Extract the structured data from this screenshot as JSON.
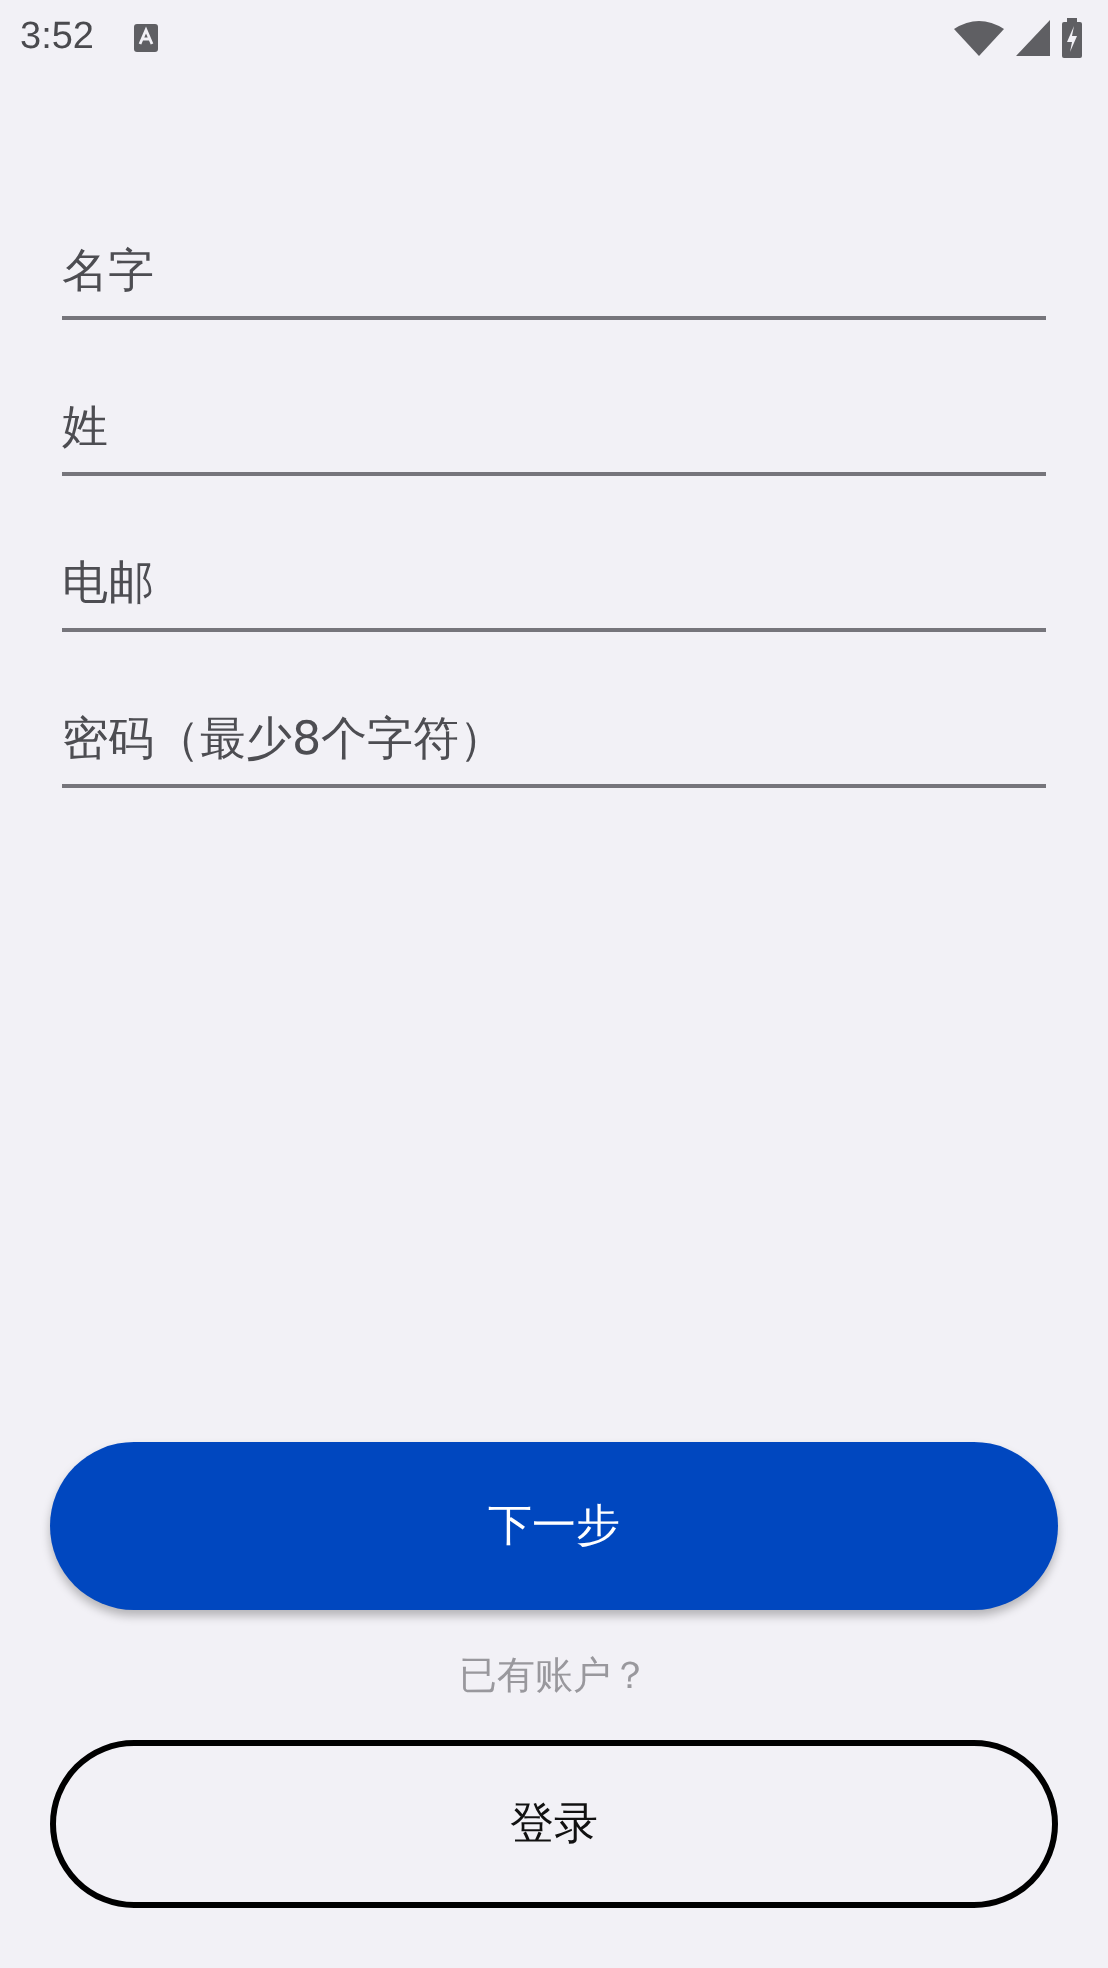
{
  "status_bar": {
    "time": "3:52"
  },
  "fields": [
    {
      "placeholder": "名字"
    },
    {
      "placeholder": "姓"
    },
    {
      "placeholder": "电邮"
    },
    {
      "placeholder": "密码（最少8个字符）"
    }
  ],
  "actions": [
    {
      "kind": "primary",
      "label": "下一步"
    },
    {
      "kind": "note",
      "label": "已有账户？"
    },
    {
      "kind": "outlined",
      "label": "登录"
    }
  ]
}
